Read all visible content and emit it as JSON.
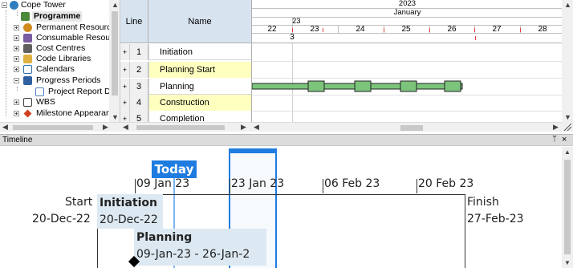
{
  "tree": {
    "items": [
      {
        "label": "Cope Tower",
        "icon": "globe-icon",
        "color": "#2f7fbf"
      },
      {
        "label": "Programme",
        "icon": "schedule-icon",
        "color": "#4a8a3a",
        "selected": true
      },
      {
        "label": "Permanent Resources",
        "icon": "person-icon",
        "color": "#d08a20"
      },
      {
        "label": "Consumable Resources",
        "icon": "consumable-icon",
        "color": "#7a5aa0"
      },
      {
        "label": "Cost Centres",
        "icon": "building-icon",
        "color": "#606060"
      },
      {
        "label": "Code Libraries",
        "icon": "folder-icon",
        "color": "#e0b040"
      },
      {
        "label": "Calendars",
        "icon": "calendar-icon",
        "color": "#3070b0"
      },
      {
        "label": "Progress Periods",
        "icon": "progress-icon",
        "color": "#3060a0"
      },
      {
        "label": "Project Report Da",
        "icon": "report-icon",
        "color": "#5080c0"
      },
      {
        "label": "WBS",
        "icon": "wbs-icon",
        "color": "#404040"
      },
      {
        "label": "Milestone Appearance",
        "icon": "milestone-diamond-icon",
        "color": "#d04020"
      }
    ]
  },
  "grid": {
    "col_line": "Line",
    "col_name": "Name",
    "rows": [
      {
        "line": "1",
        "name": "Initiation",
        "milestone": false
      },
      {
        "line": "2",
        "name": "Planning Start",
        "milestone": true
      },
      {
        "line": "3",
        "name": "Planning",
        "milestone": false
      },
      {
        "line": "4",
        "name": "Construction",
        "milestone": true
      },
      {
        "line": "5",
        "name": "Completion",
        "milestone": false
      }
    ]
  },
  "gantt": {
    "year": "2023",
    "month": "January",
    "week": "23",
    "days": [
      "22",
      "23",
      "24",
      "25",
      "26",
      "27",
      "28"
    ],
    "day_number": "3",
    "bar_color": "#7cc47c"
  },
  "timeline": {
    "title": "Timeline",
    "pin": "ᛘ",
    "close": "×",
    "today": "Today",
    "dates": [
      "09 Jan 23",
      "23 Jan 23",
      "06 Feb 23",
      "20 Feb 23"
    ],
    "start_label": "Start",
    "start_date": "20-Dec-22",
    "finish_label": "Finish",
    "finish_date": "27-Feb-23",
    "tasks": [
      {
        "name": "Initiation",
        "dates": "20-Dec-22"
      },
      {
        "name": "Planning",
        "dates": "09-Jan-23 - 26-Jan-2"
      }
    ],
    "accent": "#1e7ce0"
  }
}
